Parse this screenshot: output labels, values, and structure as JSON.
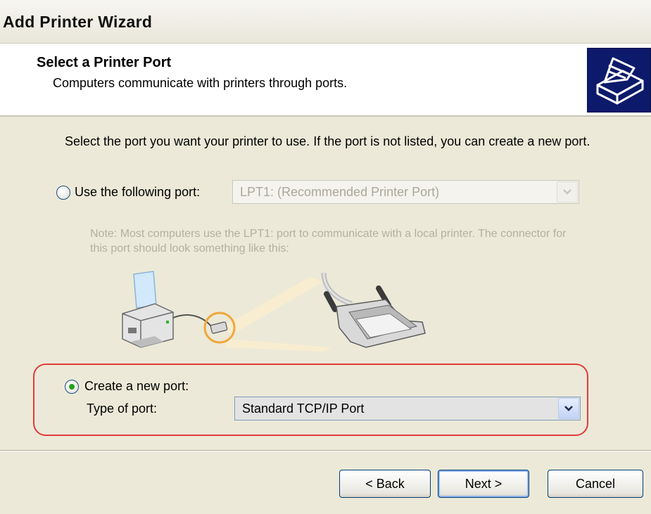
{
  "window": {
    "title": "Add Printer Wizard"
  },
  "header": {
    "title": "Select a Printer Port",
    "subtitle": "Computers communicate with printers through ports.",
    "icon": "printer-wizard-icon"
  },
  "instruction": "Select the port you want your printer to use.  If the port is not listed, you can create a new port.",
  "use_port": {
    "label": "Use the following port:",
    "selected": false,
    "enabled": false,
    "value": "LPT1: (Recommended Printer Port)"
  },
  "note": "Note: Most computers use the LPT1: port to communicate with a local printer. The connector for this port should look something like this:",
  "create_port": {
    "label": "Create a new port:",
    "selected": true,
    "type_label": "Type of port:",
    "type_value": "Standard TCP/IP Port"
  },
  "buttons": {
    "back": "< Back",
    "next": "Next >",
    "cancel": "Cancel"
  },
  "colors": {
    "highlight": "#e23b3b",
    "header_icon_bg": "#0d1a6b",
    "radio_dot": "#21a121",
    "dialog_bg": "#ece9d8"
  }
}
